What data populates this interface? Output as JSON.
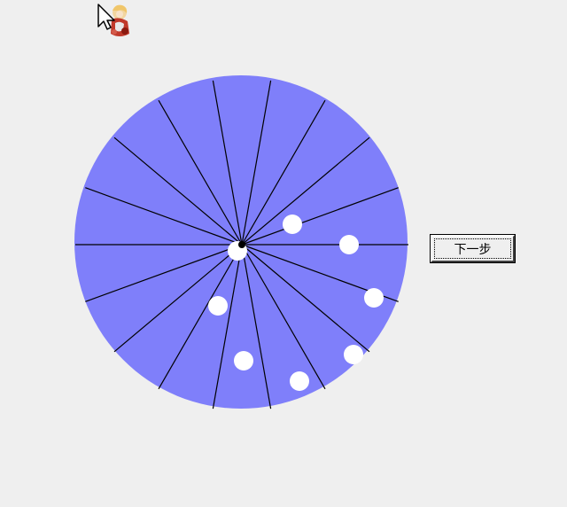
{
  "colors": {
    "background": "#efefef",
    "disc": "#7f7ffa",
    "spokes": "#000000",
    "dots": "#ffffff"
  },
  "icons": {
    "cursor": "arrow-cursor-icon",
    "sprite": "character-sprite-icon"
  },
  "wheel": {
    "spoke_count": 18,
    "dot_count": 8
  },
  "controls": {
    "next_label": "下一步"
  }
}
